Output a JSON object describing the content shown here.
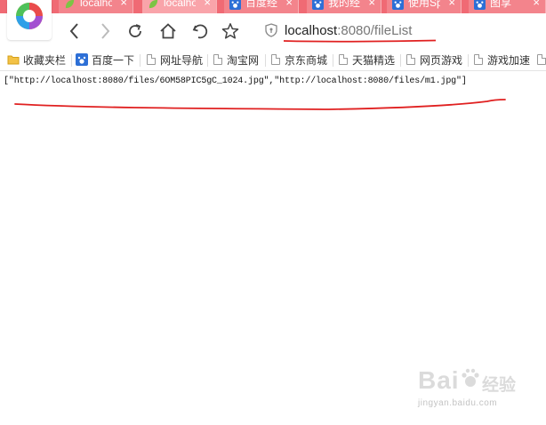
{
  "browser": {
    "tabs": [
      {
        "title": "localhost",
        "icon": "leaf-icon",
        "active": false
      },
      {
        "title": "localhost",
        "icon": "leaf-icon",
        "active": true
      },
      {
        "title": "百度经验",
        "icon": "paw-icon",
        "active": false
      },
      {
        "title": "我的经验",
        "icon": "paw-icon",
        "active": false
      },
      {
        "title": "使用Spring",
        "icon": "paw-icon",
        "active": false
      },
      {
        "title": "图享",
        "icon": "paw-icon",
        "active": false
      }
    ],
    "tab_close_glyph": "×",
    "address": {
      "host": "localhost",
      "path": ":8080/fileList"
    },
    "nav_icons": [
      "back-icon",
      "forward-icon",
      "reload-icon",
      "home-icon",
      "undo-icon",
      "star-icon"
    ],
    "accent_color": "#f06a74"
  },
  "bookmarks": [
    {
      "label": "收藏夹栏",
      "icon": "folder-icon"
    },
    {
      "label": "百度一下",
      "icon": "paw-icon"
    },
    {
      "label": "网址导航",
      "icon": "page-icon"
    },
    {
      "label": "淘宝网",
      "icon": "page-icon"
    },
    {
      "label": "京东商城",
      "icon": "page-icon"
    },
    {
      "label": "天猫精选",
      "icon": "page-icon"
    },
    {
      "label": "网页游戏",
      "icon": "page-icon"
    },
    {
      "label": "游戏加速",
      "icon": "page-icon"
    }
  ],
  "page": {
    "body_text": "[\"http://localhost:8080/files/6OM58PIC5gC_1024.jpg\",\"http://localhost:8080/files/m1.jpg\"]",
    "annotation_color": "#e02020"
  },
  "watermark": {
    "brand": "Bai",
    "brand_cn": "经验",
    "site": "jingyan.baidu.com"
  }
}
